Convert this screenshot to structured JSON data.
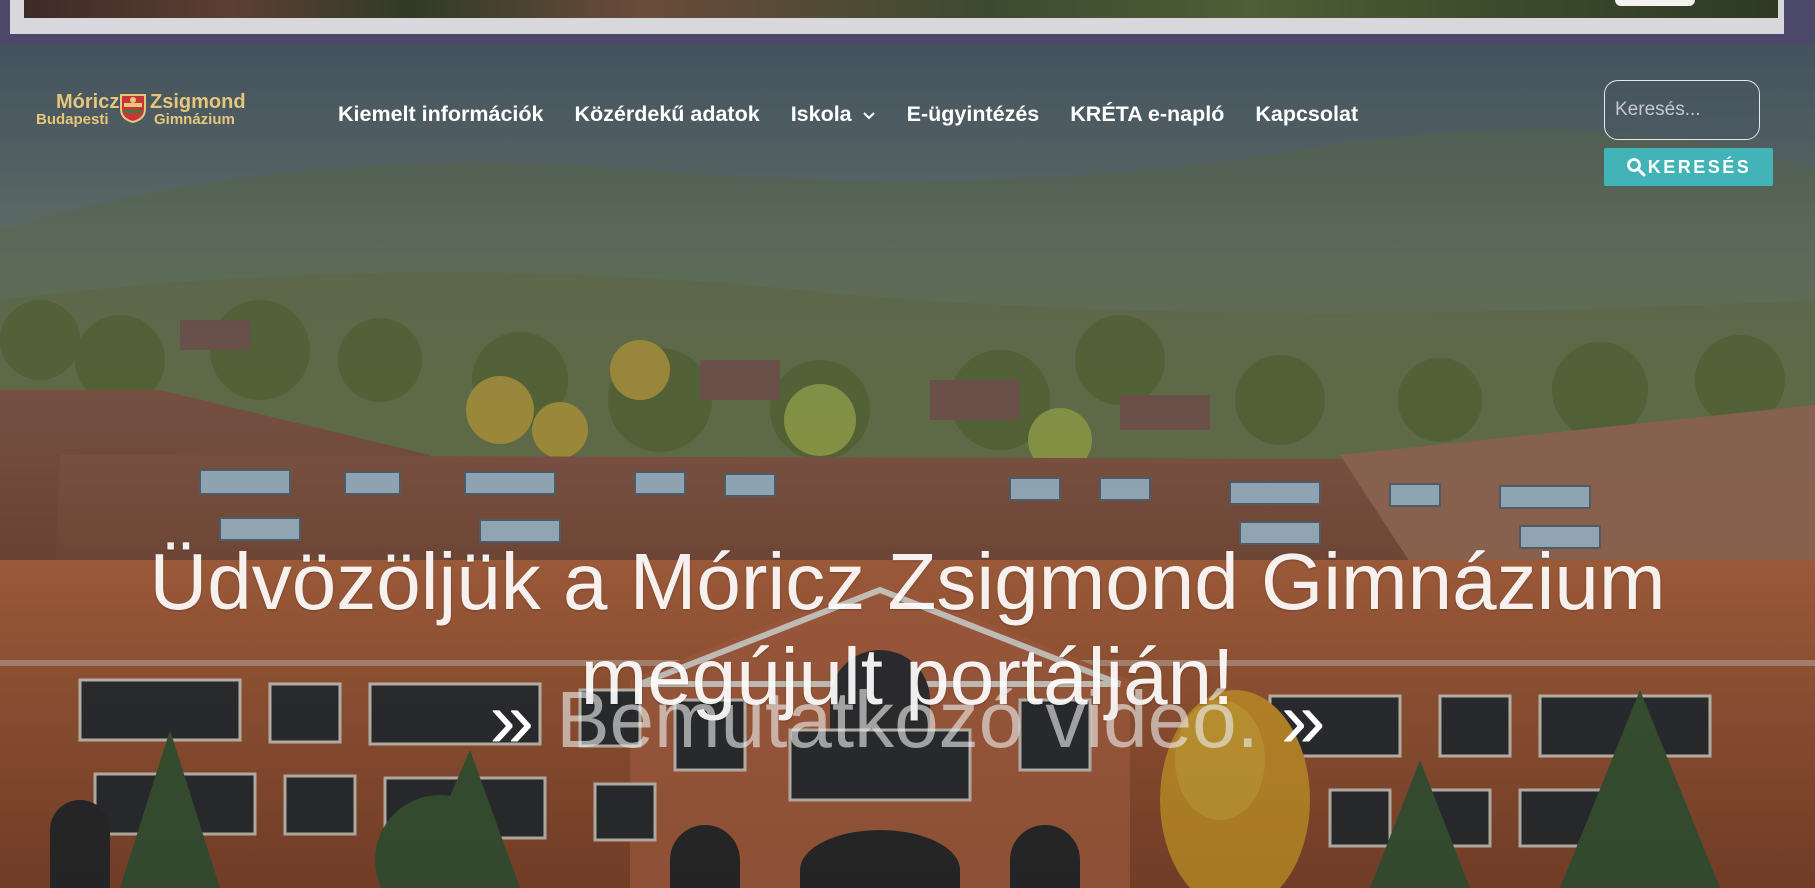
{
  "logo": {
    "line1_left": "Móricz",
    "line1_right": "Zsigmond",
    "line2_left": "Budapesti",
    "line2_right": "Gimnázium",
    "crest_icon": "school-crest-icon"
  },
  "nav": {
    "items": [
      {
        "label": "Kiemelt információk"
      },
      {
        "label": "Közérdekű adatok"
      },
      {
        "label": "Iskola",
        "dropdown_icon": "chevron-down-icon"
      },
      {
        "label": "E-ügyintézés"
      },
      {
        "label": "KRÉTA e-napló"
      },
      {
        "label": "Kapcsolat"
      }
    ]
  },
  "search": {
    "placeholder": "Keresés...",
    "button_label": "KERESÉS",
    "button_icon": "search-icon"
  },
  "hero": {
    "headline_line1": "Üdvözöljük a Móricz Zsigmond Gimnázium",
    "headline_line2": "megújult portálján!",
    "video_arrow_left": "» ",
    "video_text": "Bemutatkozó videó.",
    "video_arrow_right": " »"
  },
  "colors": {
    "accent": "#42b4b8",
    "logo_gold": "#e6c67a",
    "top_strip": "#4b4869"
  }
}
